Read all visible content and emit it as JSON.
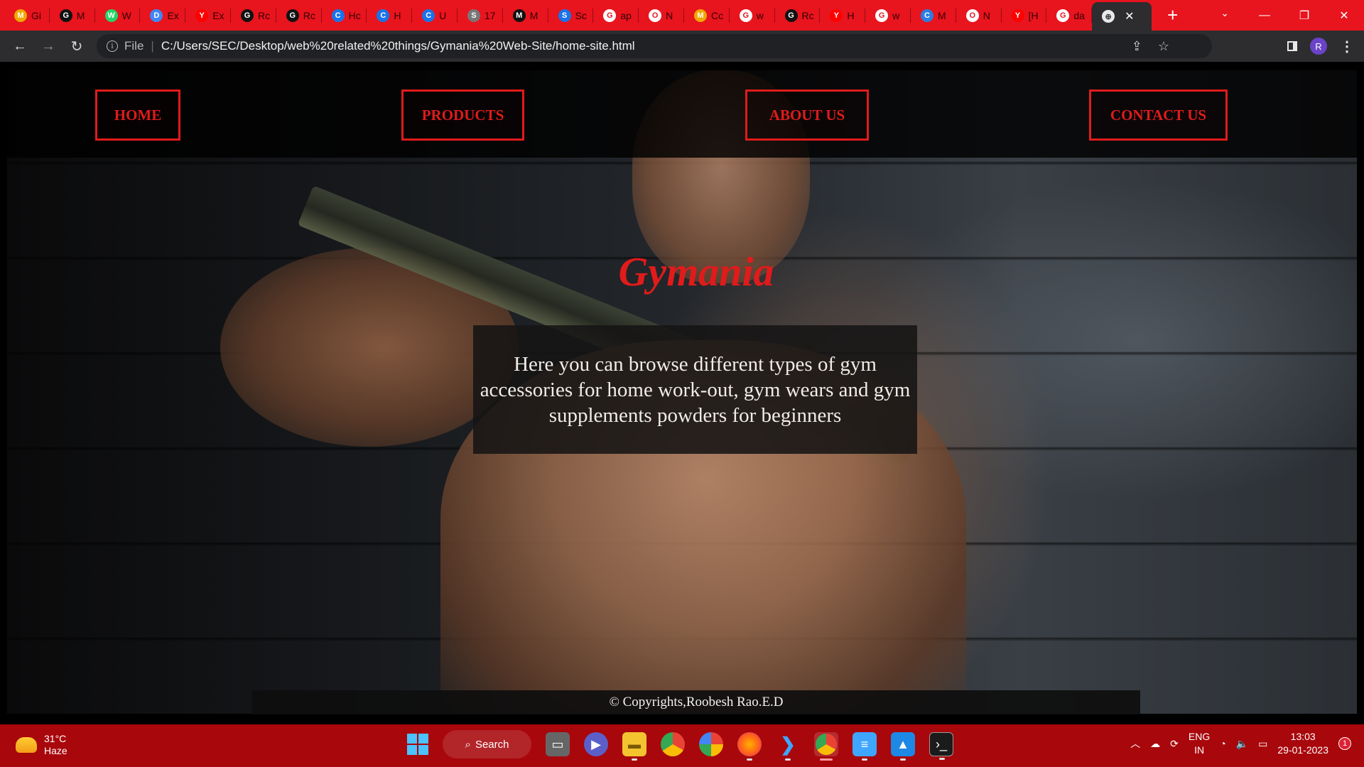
{
  "browser": {
    "tabs": [
      {
        "favicon": "monkey-icon",
        "title": "Gi",
        "color": "#f0a800"
      },
      {
        "favicon": "github-icon",
        "title": "M",
        "color": "#111111"
      },
      {
        "favicon": "whatsapp-icon",
        "title": "W",
        "color": "#25d366"
      },
      {
        "favicon": "docs-icon",
        "title": "Ex",
        "color": "#4285f4"
      },
      {
        "favicon": "youtube-icon",
        "title": "Ex",
        "color": "#ff0000"
      },
      {
        "favicon": "github-icon",
        "title": "Rc",
        "color": "#111111"
      },
      {
        "favicon": "github-icon",
        "title": "Rc",
        "color": "#111111"
      },
      {
        "favicon": "c-icon",
        "title": "Hc",
        "color": "#1a73e8"
      },
      {
        "favicon": "c-icon",
        "title": "H",
        "color": "#1a73e8"
      },
      {
        "favicon": "c-icon",
        "title": "U",
        "color": "#1a73e8"
      },
      {
        "favicon": "s-icon",
        "title": "17",
        "color": "#777777"
      },
      {
        "favicon": "medium-icon",
        "title": "M",
        "color": "#111111"
      },
      {
        "favicon": "s-icon",
        "title": "Sc",
        "color": "#1a73e8"
      },
      {
        "favicon": "google-icon",
        "title": "ap",
        "color": "#ffffff"
      },
      {
        "favicon": "opera-icon",
        "title": "N",
        "color": "#ffffff"
      },
      {
        "favicon": "monkey-icon",
        "title": "Cc",
        "color": "#f0a800"
      },
      {
        "favicon": "google-icon",
        "title": "w",
        "color": "#ffffff"
      },
      {
        "favicon": "github-icon",
        "title": "Rc",
        "color": "#111111"
      },
      {
        "favicon": "youtube-icon",
        "title": "H",
        "color": "#ff0000"
      },
      {
        "favicon": "google-icon",
        "title": "w",
        "color": "#ffffff"
      },
      {
        "favicon": "colorful-icon",
        "title": "M",
        "color": "#2a7de1"
      },
      {
        "favicon": "opera-icon",
        "title": "N",
        "color": "#ffffff"
      },
      {
        "favicon": "youtube-icon",
        "title": "[H",
        "color": "#ff0000"
      },
      {
        "favicon": "google-icon",
        "title": "da",
        "color": "#ffffff"
      }
    ],
    "active_tab": {
      "favicon": "globe-icon",
      "close": "✕"
    },
    "new_tab": "+",
    "tab_search": "⌄",
    "window_controls": {
      "minimize": "—",
      "restore": "❐",
      "close": "✕"
    },
    "nav": {
      "back": "←",
      "forward": "→",
      "reload": "↻"
    },
    "address": {
      "scheme": "File",
      "url": "C:/Users/SEC/Desktop/web%20related%20things/Gymania%20Web-Site/home-site.html"
    },
    "profile_initial": "R"
  },
  "page": {
    "nav": [
      {
        "label": "HOME"
      },
      {
        "label": "PRODUCTS"
      },
      {
        "label": "ABOUT US"
      },
      {
        "label": "CONTACT US"
      }
    ],
    "title": "Gymania",
    "description": "Here you can browse different types of gym accessories for home work-out, gym wears and gym supplements powders for beginners",
    "footer": "© Copyrights,Roobesh Rao.E.D",
    "accent_color": "#e01b1b"
  },
  "taskbar": {
    "weather": {
      "temp": "31°C",
      "condition": "Haze"
    },
    "search_label": "Search",
    "apps": [
      "task-view-icon",
      "zoom-icon",
      "file-explorer-icon",
      "chrome-icon",
      "photos-icon",
      "firefox-icon",
      "vscode-icon",
      "chrome-profile-icon",
      "notepad-icon",
      "photo-editor-icon",
      "terminal-icon"
    ],
    "tray": {
      "lang_top": "ENG",
      "lang_bottom": "IN",
      "time": "13:03",
      "date": "29-01-2023",
      "notifications": "1"
    }
  }
}
